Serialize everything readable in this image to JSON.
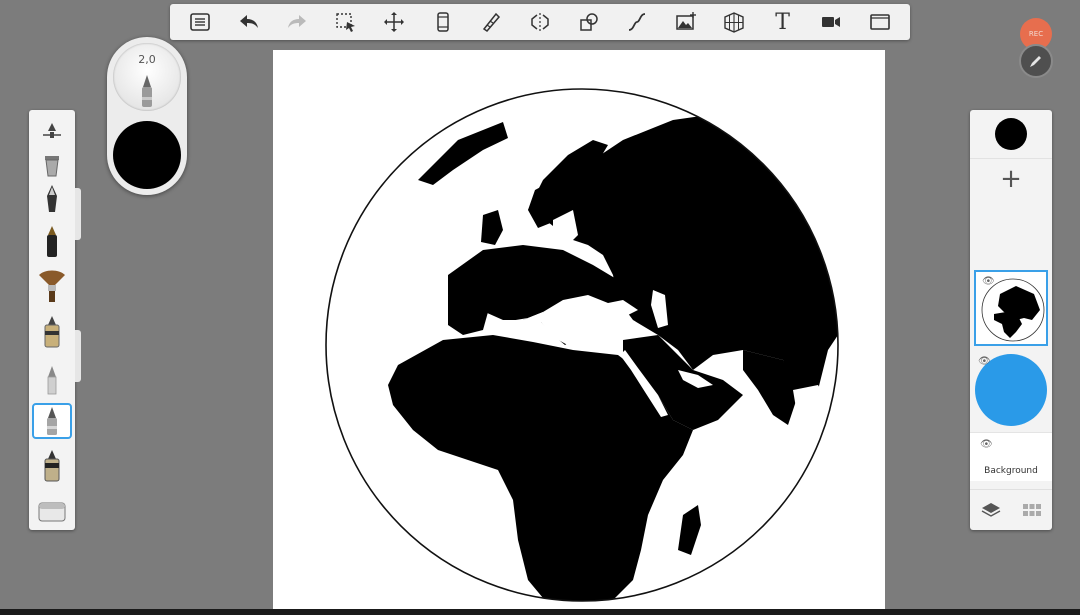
{
  "app": {
    "brush_size_value": "2,0",
    "current_color": "#000000",
    "accent_color": "#3aa0e8",
    "record_label": "REC"
  },
  "toolbar": {
    "tools": [
      {
        "name": "list-icon",
        "state": "enabled"
      },
      {
        "name": "undo-icon",
        "state": "enabled"
      },
      {
        "name": "redo-icon",
        "state": "disabled"
      },
      {
        "name": "selection-icon",
        "state": "enabled"
      },
      {
        "name": "transform-icon",
        "state": "enabled"
      },
      {
        "name": "ruler-icon",
        "state": "enabled"
      },
      {
        "name": "french-curve-icon",
        "state": "enabled"
      },
      {
        "name": "symmetry-icon",
        "state": "enabled"
      },
      {
        "name": "shapes-icon",
        "state": "enabled"
      },
      {
        "name": "stroke-icon",
        "state": "enabled"
      },
      {
        "name": "image-add-icon",
        "state": "enabled"
      },
      {
        "name": "perspective-grid-icon",
        "state": "enabled"
      },
      {
        "name": "text-icon",
        "state": "enabled"
      },
      {
        "name": "video-icon",
        "state": "enabled"
      },
      {
        "name": "fullscreen-icon",
        "state": "enabled"
      }
    ],
    "text_glyph": "T"
  },
  "brush_palette": {
    "selected_index": 7,
    "brushes": [
      "brush-settings-icon",
      "paint-bucket-icon",
      "fountain-pen-icon",
      "ink-pen-icon",
      "fan-brush-icon",
      "marker-icon",
      "pencil-icon",
      "technical-pen-icon",
      "airbrush-icon",
      "eraser-icon"
    ]
  },
  "layers": {
    "add_label": "+",
    "background_label": "Background",
    "layer_fill_color": "#2a9ae8"
  }
}
